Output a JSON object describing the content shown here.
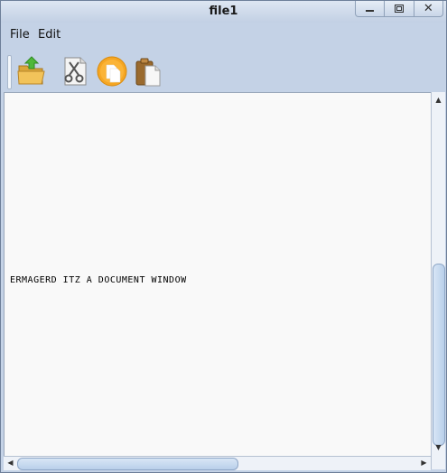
{
  "window": {
    "title": "file1",
    "controls": [
      "minimize-icon",
      "maximize-icon",
      "close-icon"
    ],
    "close_glyph": "✕"
  },
  "menubar": {
    "items": [
      {
        "label": "File"
      },
      {
        "label": "Edit"
      }
    ]
  },
  "toolbar": {
    "buttons": [
      {
        "icon": "open-folder-icon"
      },
      {
        "icon": "cut-icon"
      },
      {
        "icon": "copy-icon"
      },
      {
        "icon": "paste-icon"
      }
    ]
  },
  "document": {
    "text": "ERMAGERD ITZ A DOCUMENT WINDOW"
  },
  "scrollbars": {
    "up_arrow": "▲",
    "down_arrow": "▼",
    "left_arrow": "◀",
    "right_arrow": "▶"
  },
  "colors": {
    "title_bar": "#c4d2e6",
    "content_bg": "#f9f9f9",
    "scroll_thumb": "#b9cfea"
  }
}
